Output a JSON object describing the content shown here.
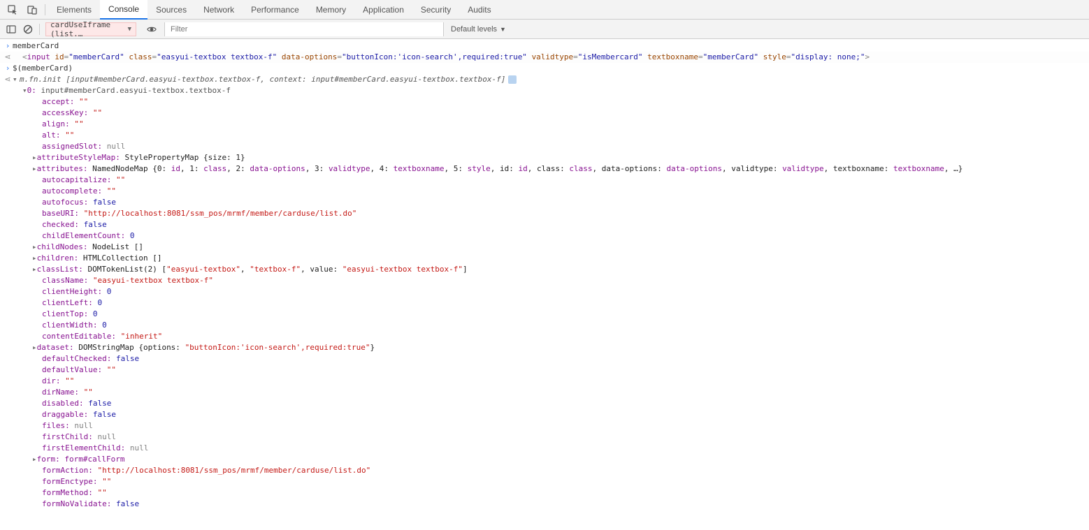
{
  "tabs": {
    "elements": "Elements",
    "console": "Console",
    "sources": "Sources",
    "network": "Network",
    "performance": "Performance",
    "memory": "Memory",
    "application": "Application",
    "security": "Security",
    "audits": "Audits"
  },
  "toolbar": {
    "context": "cardUseIframe (list.…",
    "filter_placeholder": "Filter",
    "levels": "Default levels"
  },
  "lines": {
    "l1": "memberCard",
    "l2_tag": "input",
    "l2_attrs": {
      "id_k": "id",
      "id_v": "\"memberCard\"",
      "class_k": "class",
      "class_v": "\"easyui-textbox textbox-f\"",
      "data_options_k": "data-options",
      "data_options_v": "\"buttonIcon:'icon-search',required:true\"",
      "validtype_k": "validtype",
      "validtype_v": "\"isMembercard\"",
      "textboxname_k": "textboxname",
      "textboxname_v": "\"memberCard\"",
      "style_k": "style",
      "style_v": "\"display: none;\""
    },
    "l3": "$(memberCard)",
    "l4_pre": "m.fn.init",
    "l4_b1": "input#memberCard.easyui-textbox.textbox-f",
    "l4_ctx": "context:",
    "l4_b2": "input#memberCard.easyui-textbox.textbox-f",
    "l5_k": "0:",
    "l5_v": "input#memberCard.easyui-textbox.textbox-f",
    "p_accept_k": "accept:",
    "p_accept_v": "\"\"",
    "p_accessKey_k": "accessKey:",
    "p_accessKey_v": "\"\"",
    "p_align_k": "align:",
    "p_align_v": "\"\"",
    "p_alt_k": "alt:",
    "p_alt_v": "\"\"",
    "p_assignedSlot_k": "assignedSlot:",
    "p_assignedSlot_v": "null",
    "p_attrStyleMap_k": "attributeStyleMap:",
    "p_attrStyleMap_v": "StylePropertyMap {size: 1}",
    "p_attributes_k": "attributes:",
    "p_attributes_v_a": "NamedNodeMap {0: ",
    "p_attributes_id": "id",
    "p_attributes_s1": ", 1: ",
    "p_attributes_class": "class",
    "p_attributes_s2": ", 2: ",
    "p_attributes_do": "data-options",
    "p_attributes_s3": ", 3: ",
    "p_attributes_vt": "validtype",
    "p_attributes_s4": ", 4: ",
    "p_attributes_tb": "textboxname",
    "p_attributes_s5": ", 5: ",
    "p_attributes_st": "style",
    "p_attributes_s6": ", id: ",
    "p_attributes_id2": "id",
    "p_attributes_s7": ", class: ",
    "p_attributes_class2": "class",
    "p_attributes_s8": ", data-options: ",
    "p_attributes_do2": "data-options",
    "p_attributes_s9": ", validtype: ",
    "p_attributes_vt2": "validtype",
    "p_attributes_s10": ", textboxname: ",
    "p_attributes_tb2": "textboxname",
    "p_attributes_end": ", …}",
    "p_autocap_k": "autocapitalize:",
    "p_autocap_v": "\"\"",
    "p_autocomp_k": "autocomplete:",
    "p_autocomp_v": "\"\"",
    "p_autofocus_k": "autofocus:",
    "p_autofocus_v": "false",
    "p_baseURI_k": "baseURI:",
    "p_baseURI_v": "\"http://localhost:8081/ssm_pos/mrmf/member/carduse/list.do\"",
    "p_checked_k": "checked:",
    "p_checked_v": "false",
    "p_cec_k": "childElementCount:",
    "p_cec_v": "0",
    "p_childNodes_k": "childNodes:",
    "p_childNodes_v": "NodeList []",
    "p_children_k": "children:",
    "p_children_v": "HTMLCollection []",
    "p_classList_k": "classList:",
    "p_classList_pre": "DOMTokenList(2) [",
    "p_classList_a": "\"easyui-textbox\"",
    "p_classList_c": ", ",
    "p_classList_b": "\"textbox-f\"",
    "p_classList_mid": ", value: ",
    "p_classList_val": "\"easyui-textbox textbox-f\"",
    "p_classList_end": "]",
    "p_className_k": "className:",
    "p_className_v": "\"easyui-textbox textbox-f\"",
    "p_clientH_k": "clientHeight:",
    "p_clientH_v": "0",
    "p_clientL_k": "clientLeft:",
    "p_clientL_v": "0",
    "p_clientT_k": "clientTop:",
    "p_clientT_v": "0",
    "p_clientW_k": "clientWidth:",
    "p_clientW_v": "0",
    "p_contentEd_k": "contentEditable:",
    "p_contentEd_v": "\"inherit\"",
    "p_dataset_k": "dataset:",
    "p_dataset_pre": "DOMStringMap {options: ",
    "p_dataset_v": "\"buttonIcon:'icon-search',required:true\"",
    "p_dataset_end": "}",
    "p_defChecked_k": "defaultChecked:",
    "p_defChecked_v": "false",
    "p_defValue_k": "defaultValue:",
    "p_defValue_v": "\"\"",
    "p_dir_k": "dir:",
    "p_dir_v": "\"\"",
    "p_dirName_k": "dirName:",
    "p_dirName_v": "\"\"",
    "p_disabled_k": "disabled:",
    "p_disabled_v": "false",
    "p_draggable_k": "draggable:",
    "p_draggable_v": "false",
    "p_files_k": "files:",
    "p_files_v": "null",
    "p_firstChild_k": "firstChild:",
    "p_firstChild_v": "null",
    "p_firstElChild_k": "firstElementChild:",
    "p_firstElChild_v": "null",
    "p_form_k": "form:",
    "p_form_v": "form#callForm",
    "p_formAction_k": "formAction:",
    "p_formAction_v": "\"http://localhost:8081/ssm_pos/mrmf/member/carduse/list.do\"",
    "p_formEnc_k": "formEnctype:",
    "p_formEnc_v": "\"\"",
    "p_formMethod_k": "formMethod:",
    "p_formMethod_v": "\"\"",
    "p_formNoVal_k": "formNoValidate:",
    "p_formNoVal_v": "false"
  }
}
